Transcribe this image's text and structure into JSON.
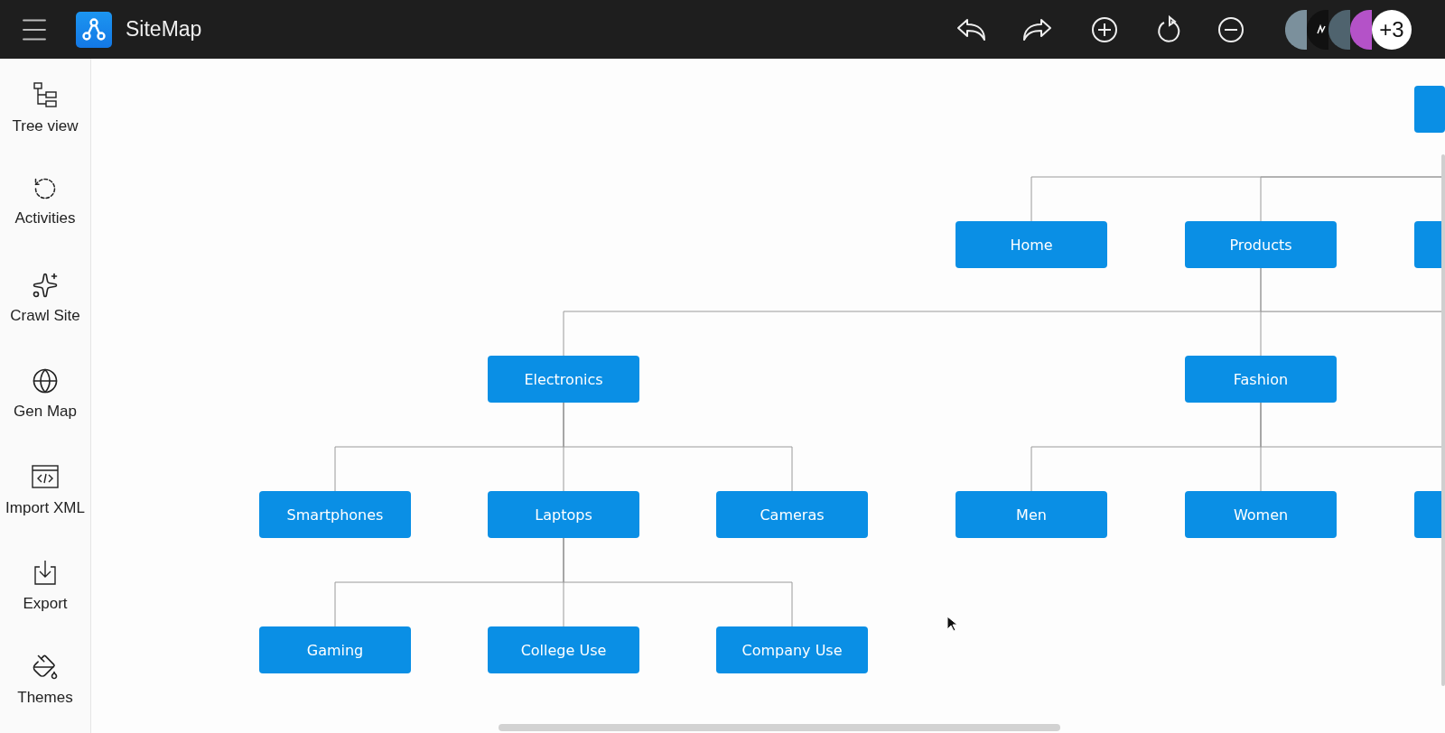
{
  "header": {
    "title": "SiteMap",
    "avatars": [
      {
        "color": "#7b909c"
      },
      {
        "kind": "logo",
        "color": "#111111"
      },
      {
        "color": "#4f636e"
      },
      {
        "color": "#b452c8"
      },
      {
        "initial": "+3",
        "color": "#ffffff"
      }
    ]
  },
  "sidebar": {
    "items": [
      {
        "label": "Tree view"
      },
      {
        "label": "Activities"
      },
      {
        "label": "Crawl Site"
      },
      {
        "label": "Gen Map"
      },
      {
        "label": "Import XML"
      },
      {
        "label": "Export"
      },
      {
        "label": "Themes"
      }
    ]
  },
  "sitemap": {
    "root": {
      "kind": "cut-off",
      "children": [
        {
          "label": "Home"
        },
        {
          "label": "Products",
          "continues_right": true,
          "children": [
            {
              "label": "Electronics",
              "children": [
                {
                  "label": "Smartphones"
                },
                {
                  "label": "Laptops",
                  "children": [
                    {
                      "label": "Gaming"
                    },
                    {
                      "label": "College Use"
                    },
                    {
                      "label": "Company Use"
                    }
                  ]
                },
                {
                  "label": "Cameras"
                }
              ]
            },
            {
              "label": "Fashion",
              "children": [
                {
                  "label": "Men"
                },
                {
                  "label": "Women"
                },
                {
                  "kind": "cut-off"
                }
              ]
            }
          ]
        },
        {
          "kind": "cut-off"
        }
      ]
    }
  }
}
